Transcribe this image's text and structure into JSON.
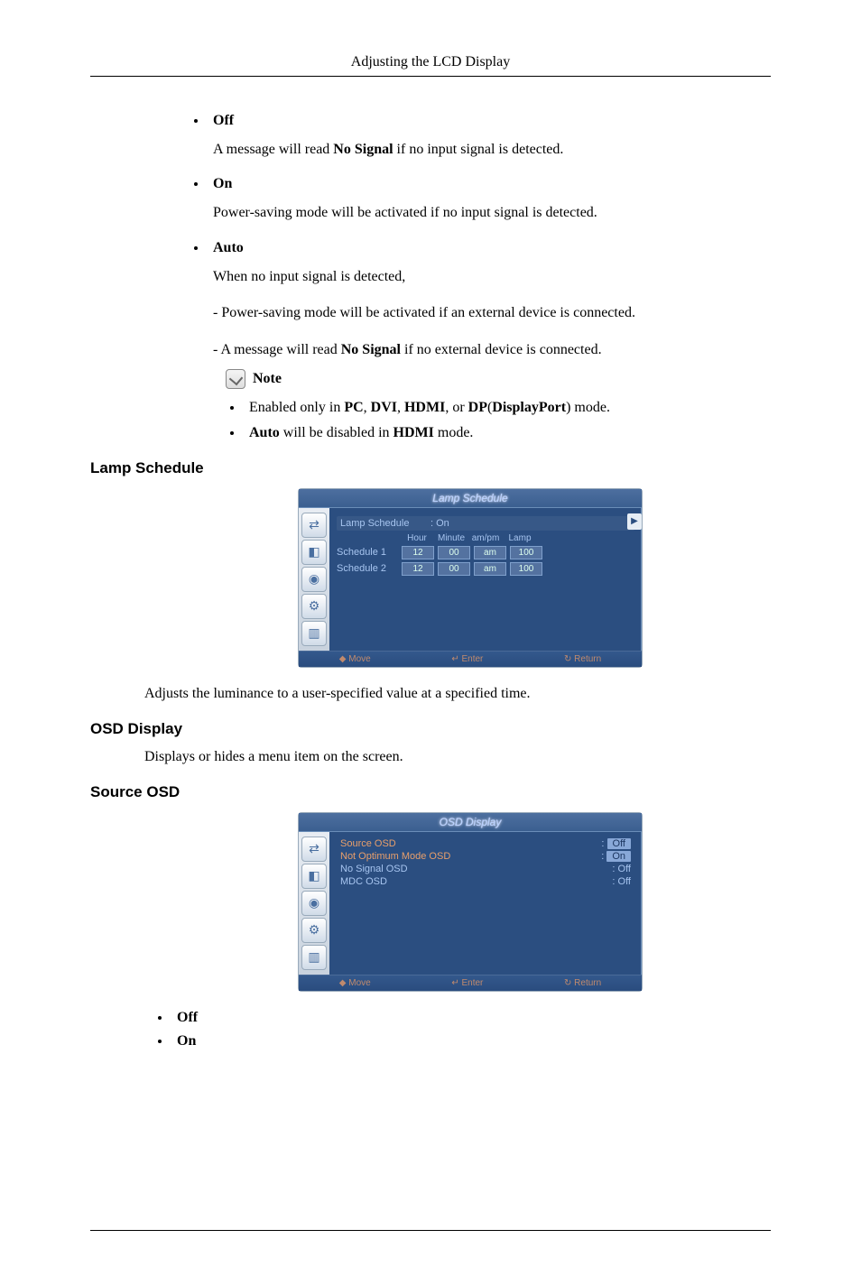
{
  "header": {
    "title": "Adjusting the LCD Display"
  },
  "options": {
    "off": {
      "title": "Off",
      "desc_pre": "A message will read ",
      "desc_bold": "No Signal",
      "desc_post": " if no input signal is detected."
    },
    "on": {
      "title": "On",
      "desc": "Power-saving mode will be activated if no input signal is detected."
    },
    "auto": {
      "title": "Auto",
      "desc1": "When no input signal is detected,",
      "desc2": "- Power-saving mode will be activated if an external device is connected.",
      "desc3_pre": "- A message will read ",
      "desc3_bold": "No Signal",
      "desc3_post": " if no external device is connected."
    }
  },
  "note": {
    "label": "Note",
    "n1_pre": "Enabled only in ",
    "n1_b1": "PC",
    "n1_m1": ", ",
    "n1_b2": "DVI",
    "n1_m2": ", ",
    "n1_b3": "HDMI",
    "n1_m3": ", or ",
    "n1_b4": "DP",
    "n1_m4": "(",
    "n1_b5": "DisplayPort",
    "n1_m5": ") mode.",
    "n2_b1": "Auto",
    "n2_m1": " will be disabled in ",
    "n2_b2": "HDMI",
    "n2_m2": " mode."
  },
  "lamp": {
    "heading": "Lamp Schedule",
    "osd_title": "Lamp Schedule",
    "row_label": "Lamp Schedule",
    "row_value": ": On",
    "cols": {
      "c1": "Hour",
      "c2": "Minute",
      "c3": "am/pm",
      "c4": "Lamp"
    },
    "s1": {
      "label": "Schedule 1",
      "hour": "12",
      "min": "00",
      "ampm": "am",
      "lamp": "100"
    },
    "s2": {
      "label": "Schedule 2",
      "hour": "12",
      "min": "00",
      "ampm": "am",
      "lamp": "100"
    },
    "footer": {
      "move": "◆ Move",
      "enter": "↵ Enter",
      "ret": "↻ Return"
    },
    "body_text": "Adjusts the luminance to a user-specified value at a specified time."
  },
  "osd_display": {
    "heading": "OSD Display",
    "body_text": "Displays or hides a menu item on the screen."
  },
  "source_osd": {
    "heading": "Source OSD",
    "osd_title": "OSD Display",
    "rows": {
      "r1k": "Source OSD",
      "r1v": "Off",
      "r2k": "Not Optimum Mode OSD",
      "r2v": "On",
      "r3k": "No Signal OSD",
      "r3v": ": Off",
      "r4k": "MDC OSD",
      "r4v": ": Off"
    },
    "footer": {
      "move": "◆ Move",
      "enter": "↵ Enter",
      "ret": "↻ Return"
    },
    "opt_off": "Off",
    "opt_on": "On"
  }
}
